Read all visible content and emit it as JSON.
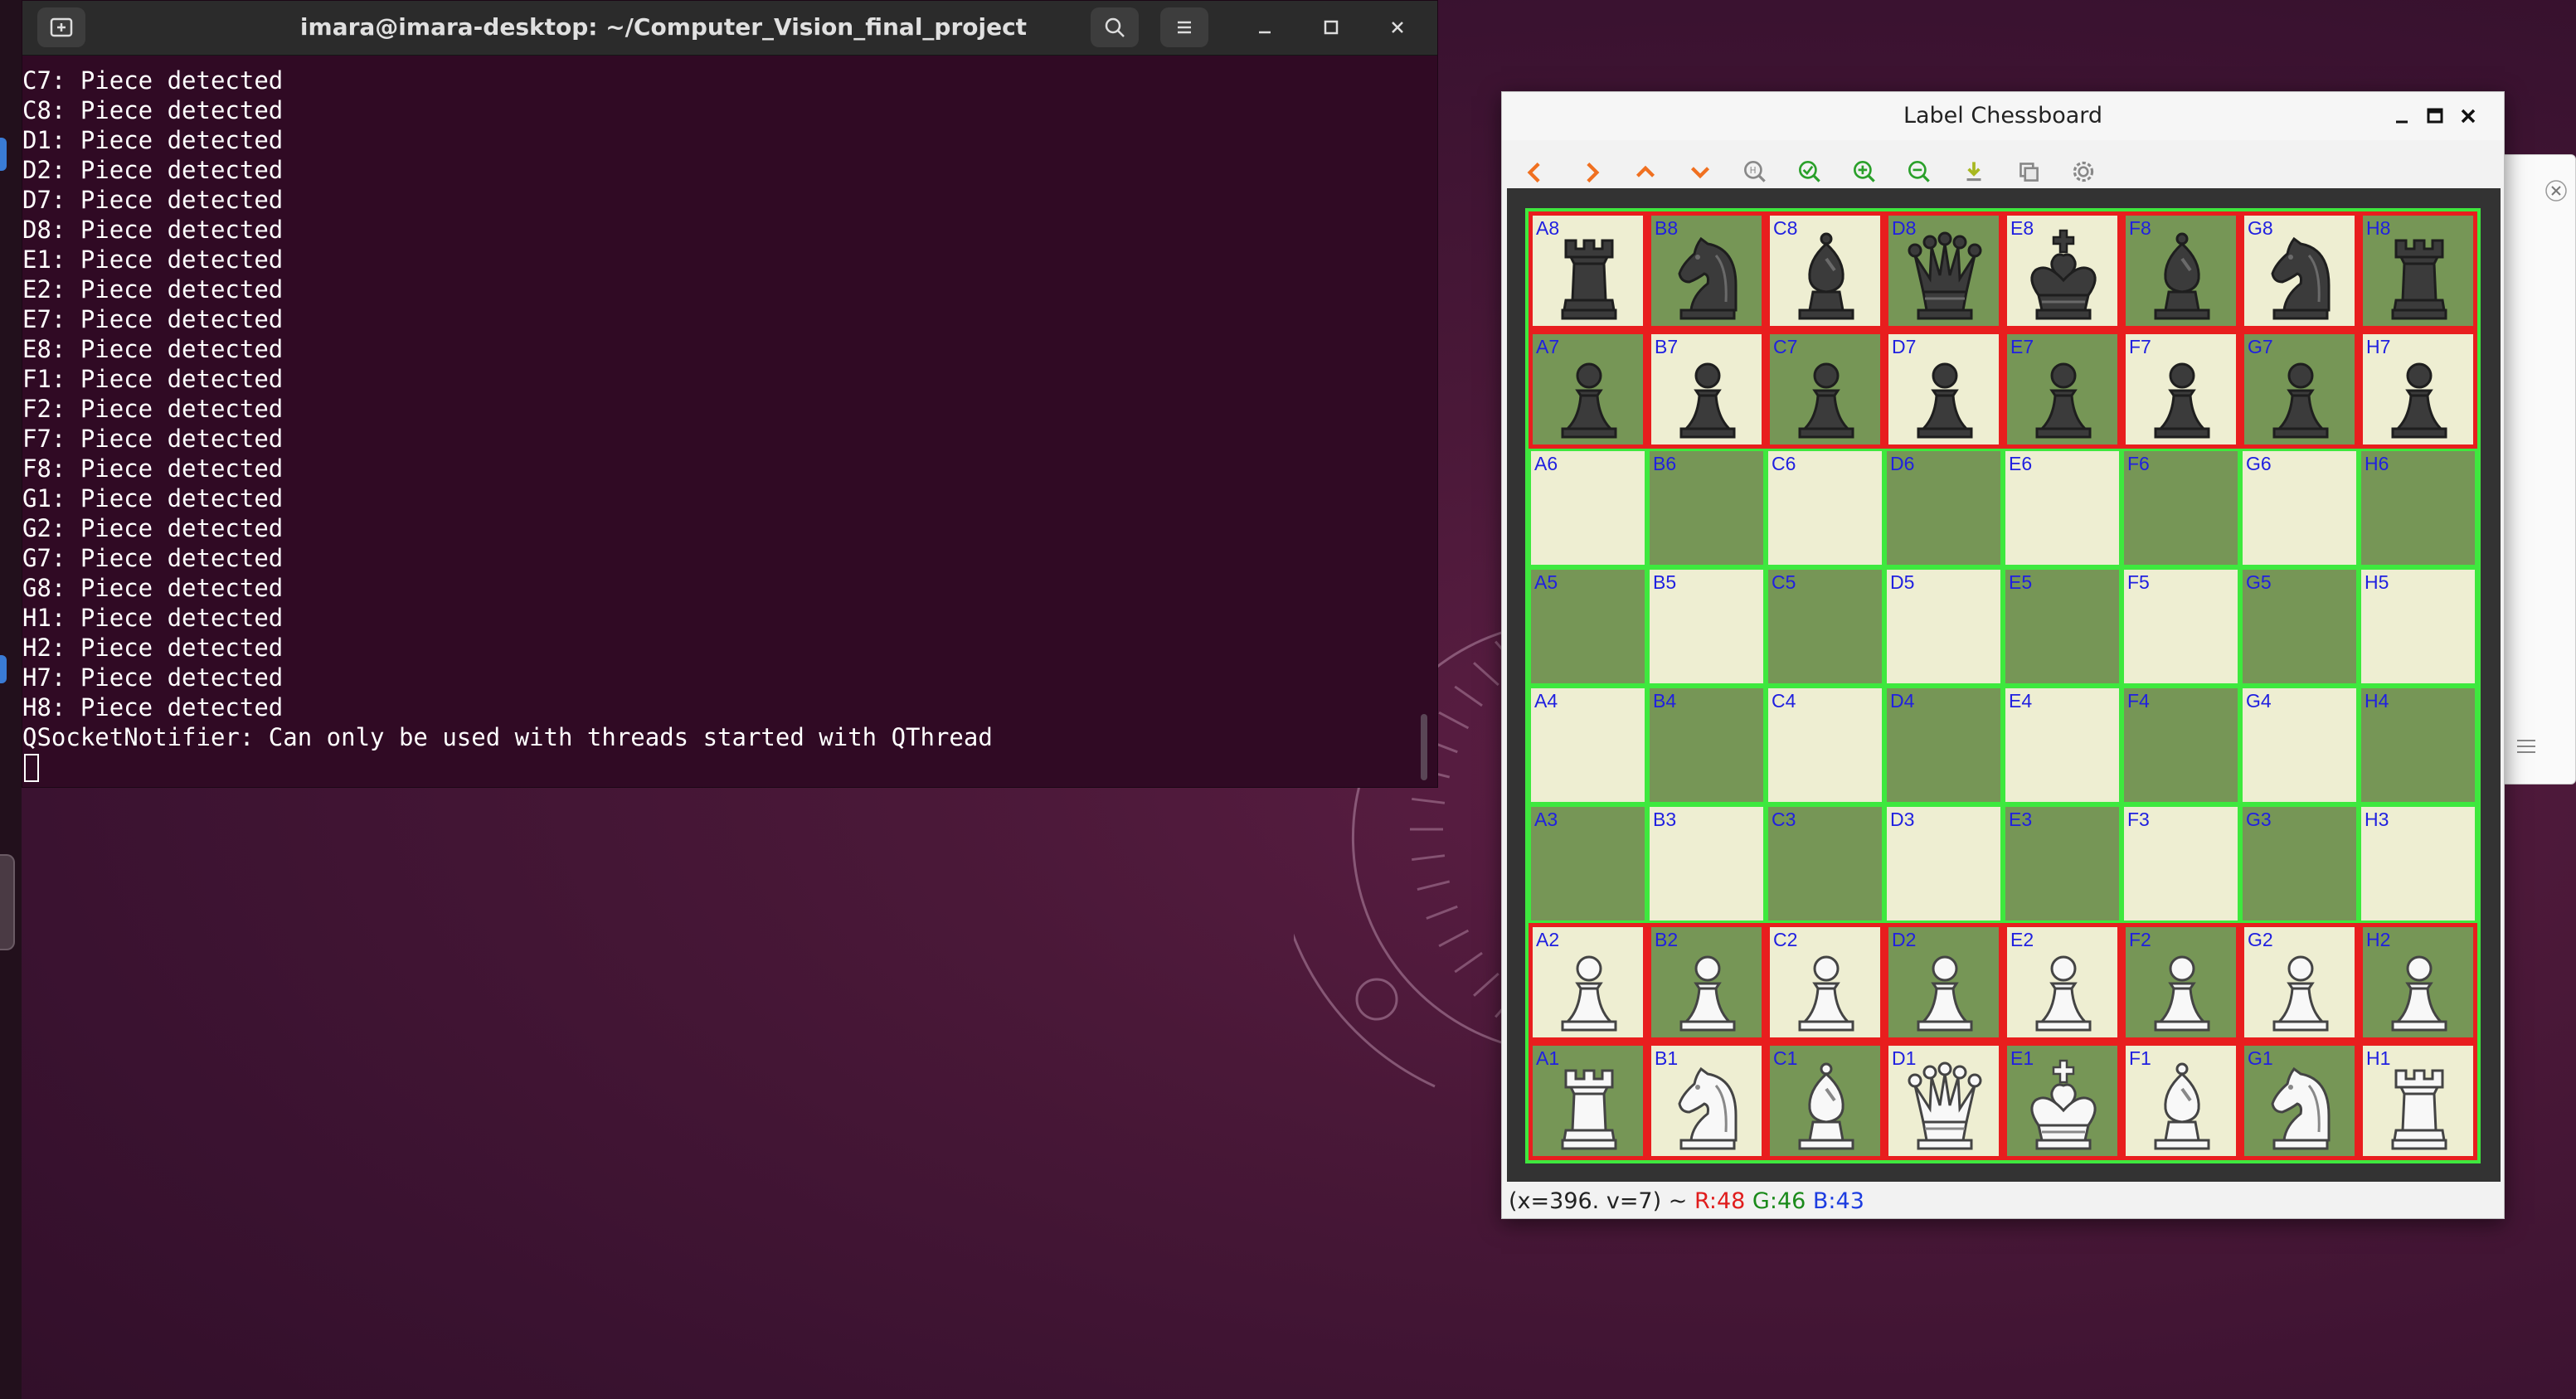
{
  "terminal": {
    "title": "imara@imara-desktop: ~/Computer_Vision_final_project",
    "lines": [
      "C7: Piece detected",
      "C8: Piece detected",
      "D1: Piece detected",
      "D2: Piece detected",
      "D7: Piece detected",
      "D8: Piece detected",
      "E1: Piece detected",
      "E2: Piece detected",
      "E7: Piece detected",
      "E8: Piece detected",
      "F1: Piece detected",
      "F2: Piece detected",
      "F7: Piece detected",
      "F8: Piece detected",
      "G1: Piece detected",
      "G2: Piece detected",
      "G7: Piece detected",
      "G8: Piece detected",
      "H1: Piece detected",
      "H2: Piece detected",
      "H7: Piece detected",
      "H8: Piece detected",
      "QSocketNotifier: Can only be used with threads started with QThread"
    ],
    "icons": {
      "new_tab": "new-tab-icon",
      "search": "search-icon",
      "menu": "hamburger-menu-icon",
      "minimize": "minimize-icon",
      "maximize": "maximize-icon",
      "close": "close-icon"
    }
  },
  "chess_window": {
    "title": "Label Chessboard",
    "toolbar": [
      "back-arrow-icon",
      "forward-arrow-icon",
      "pan-up-icon",
      "pan-down-icon",
      "zoom-reset-icon",
      "zoom-fit-icon",
      "zoom-in-icon",
      "zoom-out-icon",
      "save-image-icon",
      "copy-icon",
      "settings-icon"
    ],
    "board": {
      "ranks": [
        "8",
        "7",
        "6",
        "5",
        "4",
        "3",
        "2",
        "1"
      ],
      "files": [
        "A",
        "B",
        "C",
        "D",
        "E",
        "F",
        "G",
        "H"
      ],
      "pieces": {
        "A8": "black-rook",
        "B8": "black-knight",
        "C8": "black-bishop",
        "D8": "black-queen",
        "E8": "black-king",
        "F8": "black-bishop",
        "G8": "black-knight",
        "H8": "black-rook",
        "A7": "black-pawn",
        "B7": "black-pawn",
        "C7": "black-pawn",
        "D7": "black-pawn",
        "E7": "black-pawn",
        "F7": "black-pawn",
        "G7": "black-pawn",
        "H7": "black-pawn",
        "A2": "white-pawn",
        "B2": "white-pawn",
        "C2": "white-pawn",
        "D2": "white-pawn",
        "E2": "white-pawn",
        "F2": "white-pawn",
        "G2": "white-pawn",
        "H2": "white-pawn",
        "A1": "white-rook",
        "B1": "white-knight",
        "C1": "white-bishop",
        "D1": "white-queen",
        "E1": "white-king",
        "F1": "white-bishop",
        "G1": "white-knight",
        "H1": "white-rook"
      },
      "colors": {
        "light": "#eeeed2",
        "dark": "#769656",
        "occupied_border": "#e81e1e",
        "empty_border": "#3ee83e",
        "label": "#2020e0"
      }
    },
    "status": {
      "coords": "(x=396. v=7) ~ ",
      "r": "R:48",
      "g": "G:46",
      "b": "B:43"
    }
  }
}
